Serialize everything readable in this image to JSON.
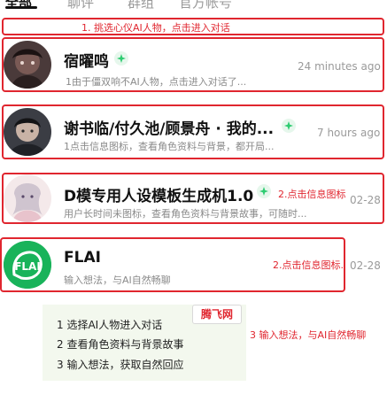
{
  "tabs": [
    "全部",
    "聊评",
    "群组",
    "官方帐号"
  ],
  "annotations": {
    "step1": "1. 挑选心仪AI人物，点击进入对话",
    "step2a": "2.点击信息图标",
    "step2b": "2.点击信息图标.",
    "step3": "3 输入想法，与AI自然畅聊"
  },
  "chats": [
    {
      "name": "宿曜鸣",
      "preview": "1由于僵双响不AI人物，点击进入对话了...",
      "time": "24 minutes ago"
    },
    {
      "name": "谢书临/付久池/顾景舟 · 我的...",
      "preview": "1点击信息图标，查看角色资料与背景，都开局...",
      "time": "7 hours ago"
    },
    {
      "name": "D模专用人设模板生成机1.0",
      "preview": "用户长时间未图标，查看角色资料与背景故事，可随时...",
      "time": "02-28"
    },
    {
      "name": "FLAI",
      "preview": "输入想法，与AI自然畅聊",
      "time": "02-28",
      "logo_text": "FLAI"
    }
  ],
  "helper": {
    "lines": [
      "1 选择AI人物进入对话",
      "2 查看角色资料与背景故事",
      "3 输入想法，获取自然回应"
    ],
    "brand": "腾飞网"
  },
  "colors": {
    "annotation_red": "#e0262f",
    "ai_badge_green": "#2ecc71",
    "flai_green": "#19b35a"
  }
}
